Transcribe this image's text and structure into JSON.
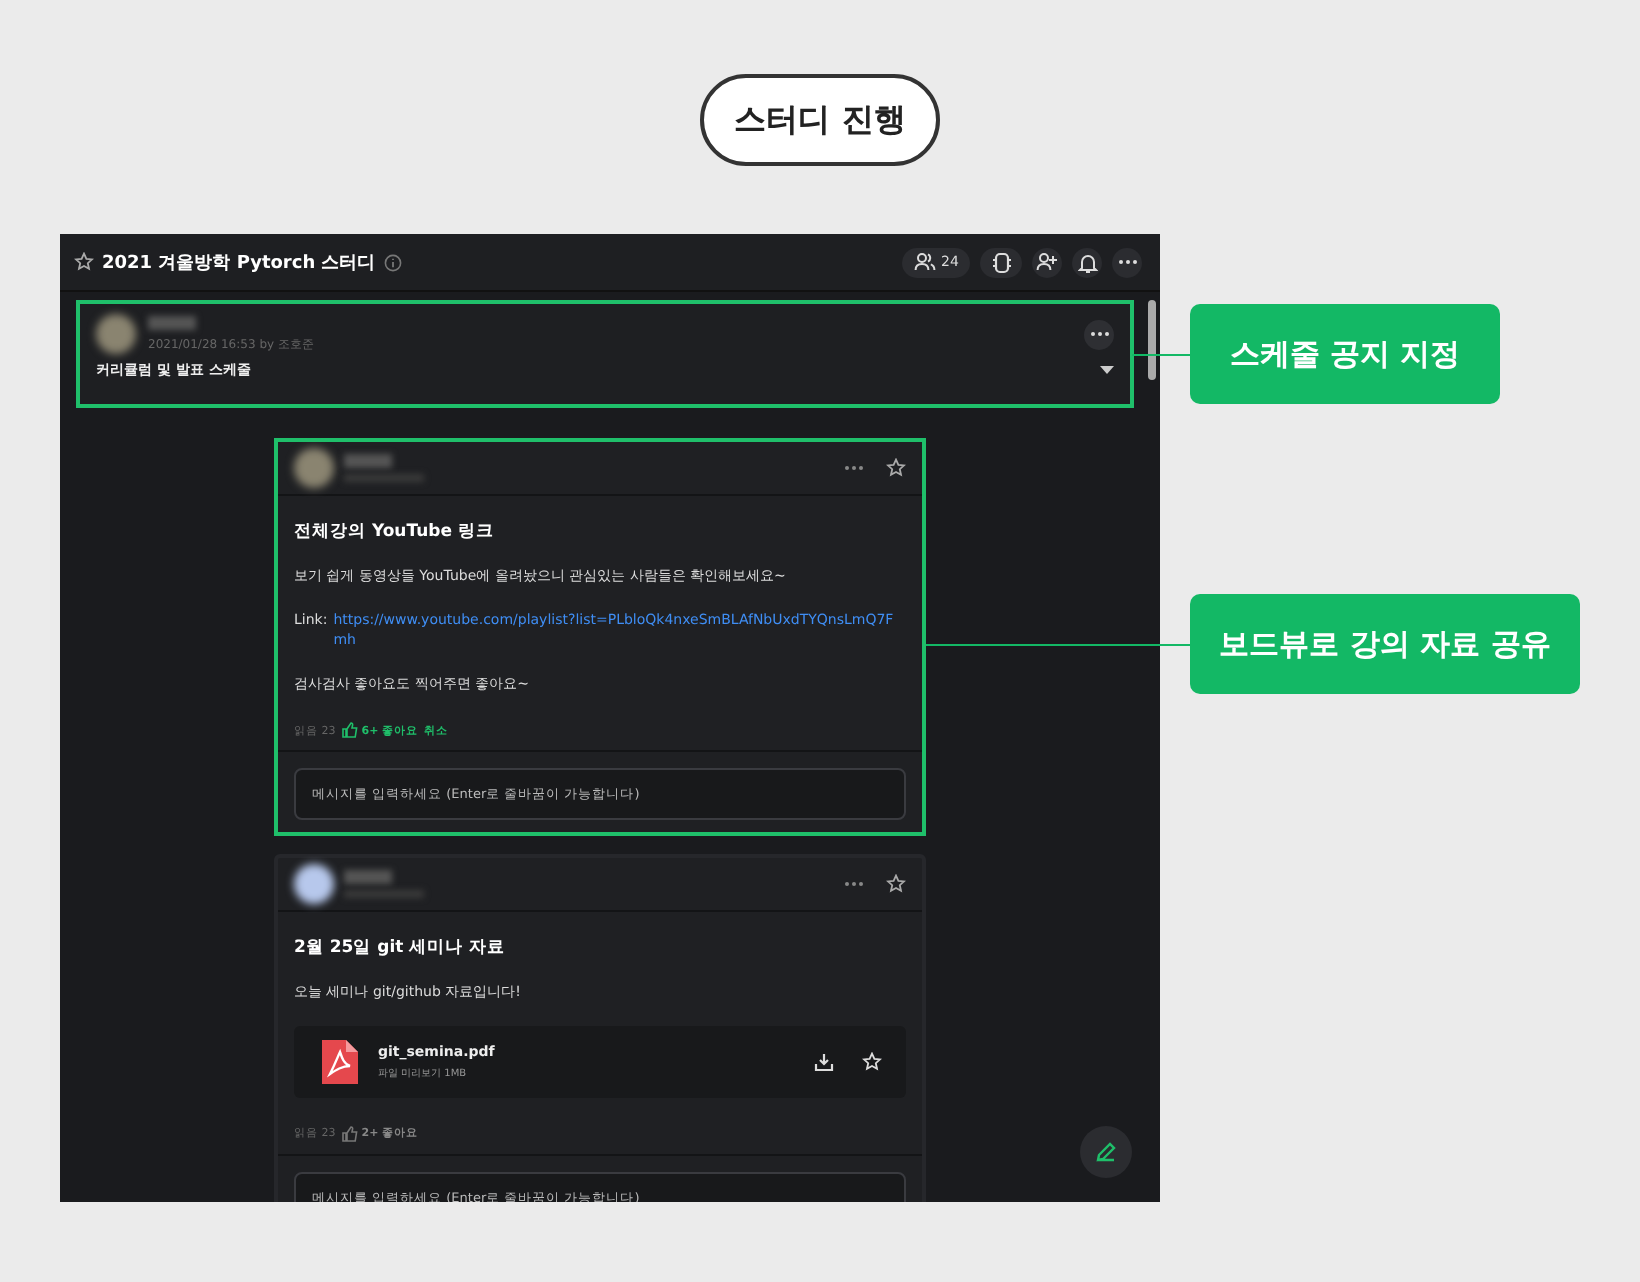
{
  "page_title": "스터디 진행",
  "channel": {
    "title": "2021 겨울방학 Pytorch 스터디",
    "favorite": false,
    "member_count": "24"
  },
  "notice": {
    "meta": "2021/01/28 16:53 by 조호준",
    "title": "커리큘럼 및 발표 스케줄",
    "highlighted": true
  },
  "posts": [
    {
      "highlighted": true,
      "title": "전체강의 YouTube 링크",
      "body": [
        {
          "kind": "text",
          "text": "보기 쉽게 동영상들 YouTube에 올려놨으니 관심있는 사람들은 확인해보세요~"
        },
        {
          "kind": "link",
          "label": "Link:",
          "url": "https://www.youtube.com/playlist?list=PLbloQk4nxeSmBLAfNbUxdTYQnsLmQ7Fmh"
        },
        {
          "kind": "text",
          "text": "검사검사 좋아요도 찍어주면 좋아요~"
        }
      ],
      "reads": "읽음 23",
      "likes": "6+ 좋아요",
      "liked": true,
      "cancel": "취소",
      "composer": {
        "placeholder": "메시지를 입력하세요 (Enter로 줄바꿈이 가능합니다)"
      }
    },
    {
      "highlighted": false,
      "title": "2월 25일 git 세미나 자료",
      "body": [
        {
          "kind": "text",
          "text": "오늘 세미나 git/github 자료입니다!"
        },
        {
          "kind": "file",
          "name": "git_semina.pdf",
          "meta": "파일 미리보기 1MB"
        }
      ],
      "reads": "읽음 23",
      "likes": "2+ 좋아요",
      "liked": false,
      "composer": {
        "placeholder": "메시지를 입력하세요 (Enter로 줄바꿈이 가능합니다)"
      }
    }
  ],
  "callouts": [
    {
      "text": "스케줄 공지 지정"
    },
    {
      "text": "보드뷰로 강의 자료 공유"
    }
  ]
}
